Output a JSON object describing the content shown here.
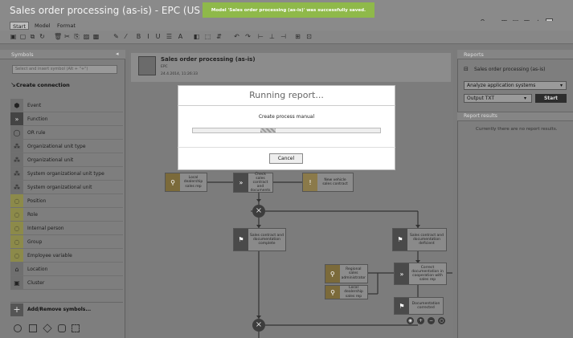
{
  "window": {
    "title": "Sales order processing (as-is) - EPC",
    "language": "(US -)",
    "toast": "Model 'Sales order processing (as-is)' was successfully saved."
  },
  "menu": {
    "items": [
      "Start",
      "Model",
      "Format"
    ]
  },
  "symbols": {
    "title": "Symbols",
    "search_placeholder": "Select and insert symbol (Alt + \"+\")",
    "create_connection": "Create connection",
    "items": [
      {
        "label": "Event",
        "icon": "event-icon"
      },
      {
        "label": "Function",
        "icon": "function-icon"
      },
      {
        "label": "OR rule",
        "icon": "or-rule-icon"
      },
      {
        "label": "Organizational unit type",
        "icon": "org-unit-type-icon"
      },
      {
        "label": "Organizational unit",
        "icon": "org-unit-icon"
      },
      {
        "label": "System organizational unit type",
        "icon": "system-org-unit-type-icon"
      },
      {
        "label": "System organizational unit",
        "icon": "system-org-unit-icon"
      },
      {
        "label": "Position",
        "icon": "position-icon"
      },
      {
        "label": "Role",
        "icon": "role-icon"
      },
      {
        "label": "Internal person",
        "icon": "internal-person-icon"
      },
      {
        "label": "Group",
        "icon": "group-icon"
      },
      {
        "label": "Employee variable",
        "icon": "employee-variable-icon"
      },
      {
        "label": "Location",
        "icon": "location-icon"
      },
      {
        "label": "Cluster",
        "icon": "cluster-icon"
      }
    ],
    "add_remove": "Add/Remove symbols..."
  },
  "model": {
    "title": "Sales order processing (as-is)",
    "type": "EPC",
    "date": "24.4.2014, 11:26:33",
    "nodes": {
      "role1": "Local dealership sales rep",
      "func1": "Check sales contract and documents",
      "info1": "New vehicle sales contract",
      "evt1": "Sales contract and documentation complete",
      "evt2": "Sales contract and documentation deficient",
      "role2": "Regional sales administrator",
      "role3": "Local dealership sales rep",
      "func2": "Correct documentation in cooperation with sales rep",
      "evt3": "Documentation corrected"
    }
  },
  "reports": {
    "title": "Reports",
    "model_name": "Sales order processing (as-is)",
    "report_select": "Analyze application systems",
    "output_select": "Output TXT",
    "start_label": "Start",
    "results_title": "Report results",
    "no_results": "Currently there are no report results."
  },
  "dialog": {
    "title": "Running report...",
    "message": "Create process manual",
    "progress": 0.08,
    "cancel_label": "Cancel"
  },
  "colors": {
    "toast_bg": "#8fb94a",
    "dark_node": "#4a4a4a",
    "role_tag": "#7b6a3a"
  }
}
